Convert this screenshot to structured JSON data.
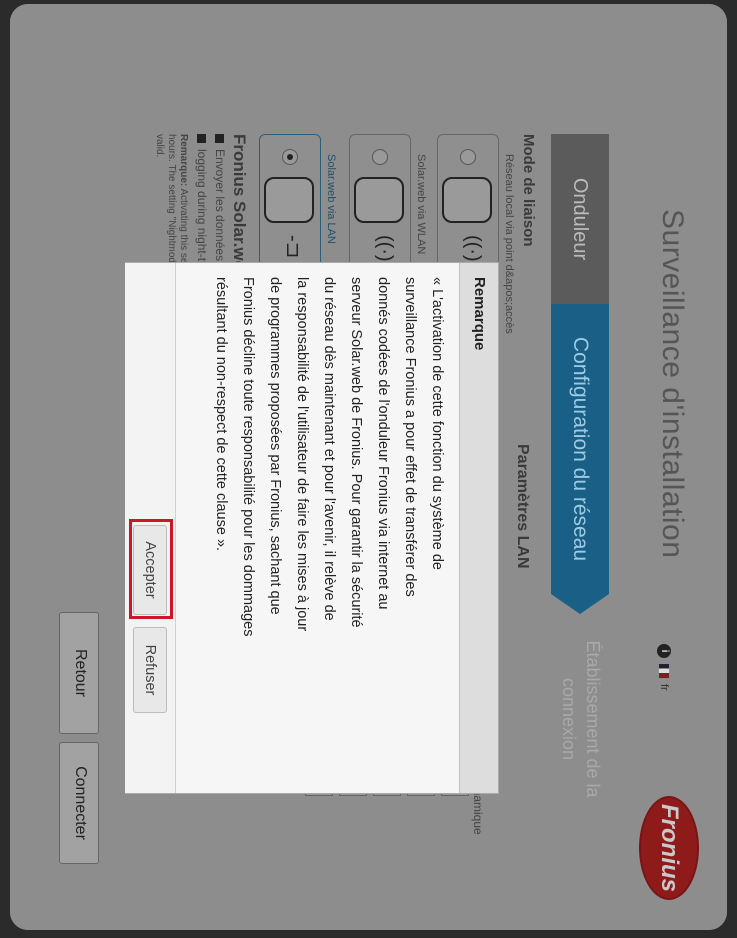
{
  "header": {
    "title": "Surveillance d'installation",
    "lang": "fr",
    "logo_text": "Fronius"
  },
  "tabs": [
    {
      "label": "Onduleur"
    },
    {
      "label": "Configuration du réseau"
    },
    {
      "label": "Établissement de la connexion"
    }
  ],
  "connection_mode": {
    "heading": "Mode de liaison",
    "options": [
      {
        "label": "Réseau local via point d&apos;accès",
        "selected": false
      },
      {
        "label": "Solar.web via WLAN",
        "selected": false
      },
      {
        "label": "Solar.web via LAN",
        "selected": true
      }
    ]
  },
  "solarweb": {
    "heading": "Fronius Solar.web",
    "checks": [
      "Envoyer les données à",
      "logging during night-time"
    ],
    "remark_bold": "Remarque:",
    "remark_text": "Activating this setting ... during night-time hours. The setting \"Nightmode\" will thereby no longer be valid."
  },
  "lan": {
    "heading": "Paramètres LAN",
    "dynamic_label": "Dynamique"
  },
  "footer": {
    "back_label": "Retour",
    "connect_label": "Connecter"
  },
  "dialog": {
    "title": "Remarque",
    "lines": [
      "« L'activation de cette fonction du système de",
      "surveillance Fronius a pour effet de transférer des",
      "donnés codées de l'onduleur Fronius via internet au",
      "serveur Solar.web de Fronius. Pour garantir la sécurité",
      "du réseau dès maintenant et pour l'avenir, il relève de",
      "la responsabilité de l'utilisateur de faire les mises à jour",
      "de programmes proposées par Fronius, sachant que",
      "Fronius décline toute responsabilité pour les dommages",
      "résultant du non-respect de cette clause »."
    ],
    "accept_label": "Accepter",
    "decline_label": "Refuser"
  },
  "colors": {
    "highlight": "#d0152b",
    "active_tab": "#1a5f86"
  }
}
